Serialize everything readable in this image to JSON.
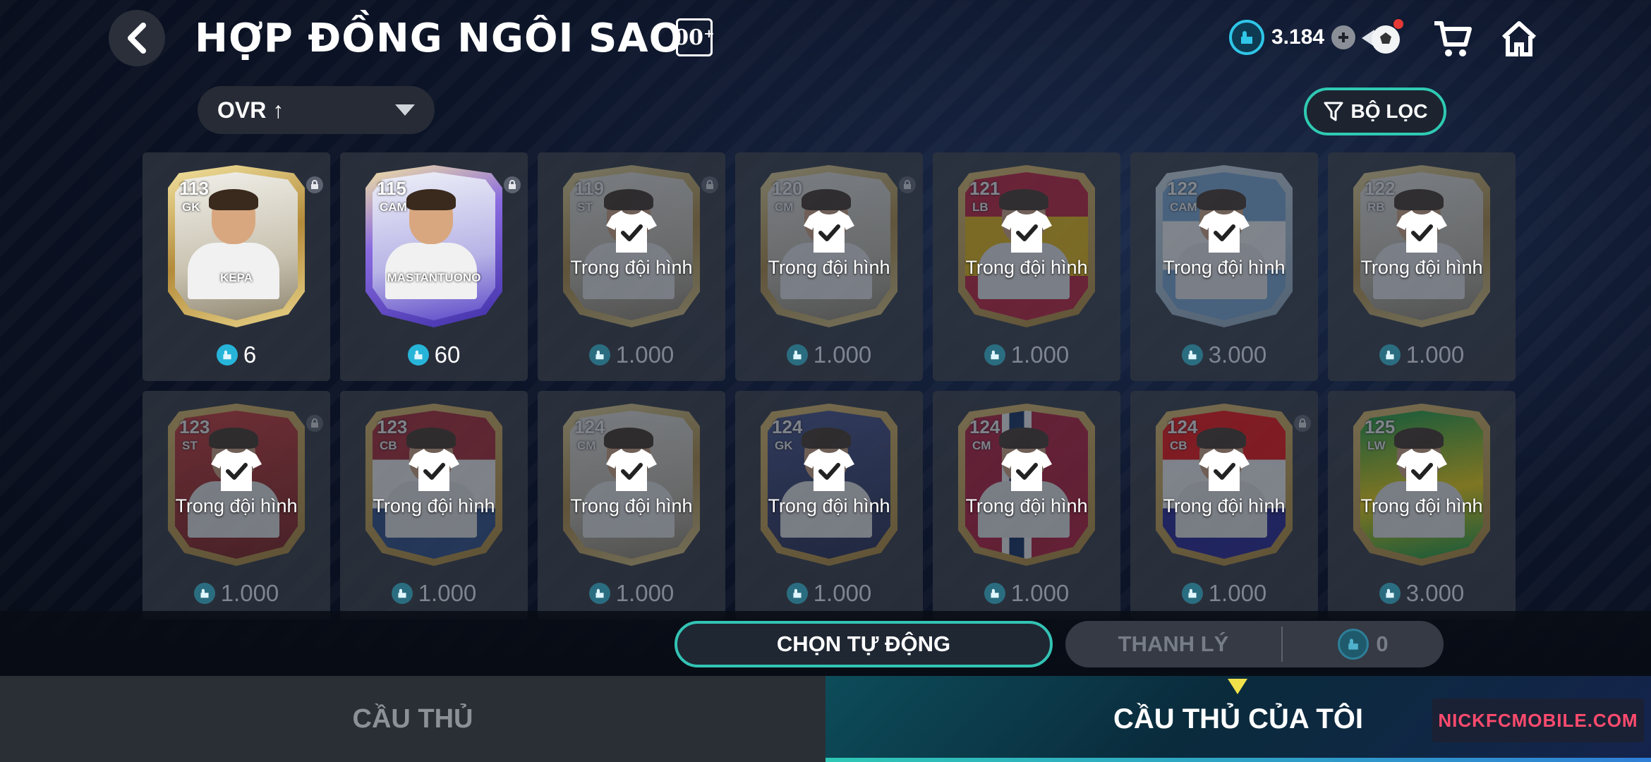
{
  "header": {
    "title": "HỢP ĐỒNG NGÔI SAO",
    "badge": "00⁺",
    "currency_value": "3.184"
  },
  "sort": {
    "label": "OVR ↑"
  },
  "filter": {
    "label": "BỘ LỌC"
  },
  "cards": [
    {
      "ovr": "113",
      "pos": "GK",
      "name": "KEPA",
      "price": "6",
      "in_squad": false,
      "locked": true,
      "theme": "gold"
    },
    {
      "ovr": "115",
      "pos": "CAM",
      "name": "MASTANTUONO",
      "price": "60",
      "in_squad": false,
      "locked": true,
      "theme": "purple"
    },
    {
      "ovr": "119",
      "pos": "ST",
      "name": "",
      "price": "1.000",
      "in_squad": true,
      "locked": true,
      "theme": "gold"
    },
    {
      "ovr": "120",
      "pos": "CM",
      "name": "",
      "price": "1.000",
      "in_squad": true,
      "locked": true,
      "theme": "gold"
    },
    {
      "ovr": "121",
      "pos": "LB",
      "name": "",
      "price": "1.000",
      "in_squad": true,
      "locked": false,
      "theme": "spain"
    },
    {
      "ovr": "122",
      "pos": "CAM",
      "name": "",
      "price": "3.000",
      "in_squad": true,
      "locked": false,
      "theme": "sky"
    },
    {
      "ovr": "122",
      "pos": "RB",
      "name": "",
      "price": "1.000",
      "in_squad": true,
      "locked": false,
      "theme": "gold"
    },
    {
      "ovr": "123",
      "pos": "ST",
      "name": "",
      "price": "1.000",
      "in_squad": true,
      "locked": true,
      "theme": "red"
    },
    {
      "ovr": "123",
      "pos": "CB",
      "name": "",
      "price": "1.000",
      "in_squad": true,
      "locked": false,
      "theme": "dutch"
    },
    {
      "ovr": "124",
      "pos": "CM",
      "name": "",
      "price": "1.000",
      "in_squad": true,
      "locked": false,
      "theme": "gold"
    },
    {
      "ovr": "124",
      "pos": "GK",
      "name": "",
      "price": "1.000",
      "in_squad": true,
      "locked": false,
      "theme": "navy"
    },
    {
      "ovr": "124",
      "pos": "CM",
      "name": "",
      "price": "1.000",
      "in_squad": true,
      "locked": false,
      "theme": "norway"
    },
    {
      "ovr": "124",
      "pos": "CB",
      "name": "",
      "price": "1.000",
      "in_squad": true,
      "locked": true,
      "theme": "croatia"
    },
    {
      "ovr": "125",
      "pos": "LW",
      "name": "",
      "price": "3.000",
      "in_squad": true,
      "locked": false,
      "theme": "brazil"
    }
  ],
  "squad_label": "Trong đội hình",
  "actions": {
    "auto_select": "CHỌN TỰ ĐỘNG",
    "sell": "THANH LÝ",
    "sell_total": "0"
  },
  "tabs": {
    "players": "CẦU THỦ",
    "my_players": "CẦU THỦ CỦA TÔI"
  },
  "watermark": "NICKFCMOBILE.COM",
  "colors": {
    "accent_teal": "#33c3b5",
    "coin_blue": "#27b4d9",
    "tab_marker": "#f0e14a"
  }
}
